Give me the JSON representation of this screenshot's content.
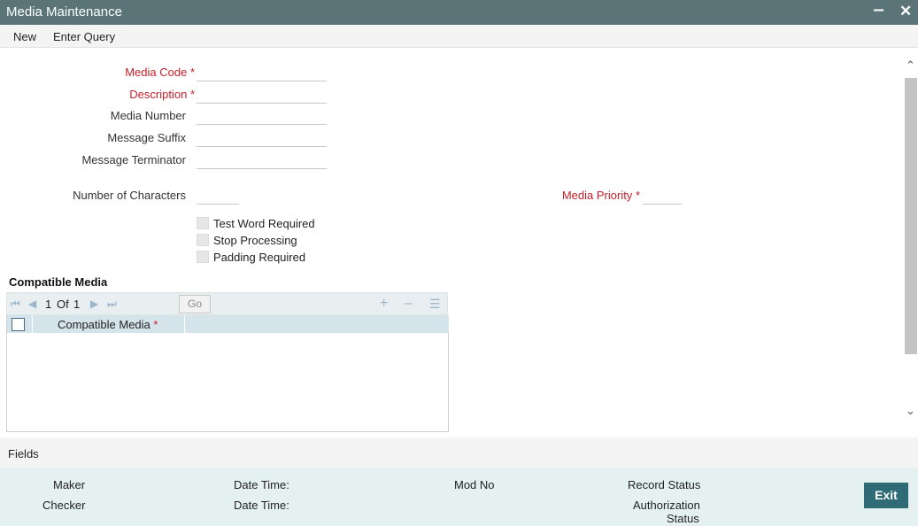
{
  "window": {
    "title": "Media Maintenance",
    "minimize_glyph": "‒",
    "close_glyph": "✕"
  },
  "menu": {
    "new": "New",
    "enter_query": "Enter Query"
  },
  "form": {
    "media_code": {
      "label": "Media Code",
      "required_mark": "*",
      "value": ""
    },
    "description": {
      "label": "Description",
      "required_mark": "*",
      "value": ""
    },
    "media_number": {
      "label": "Media Number",
      "value": ""
    },
    "message_suffix": {
      "label": "Message Suffix",
      "value": ""
    },
    "message_terminator": {
      "label": "Message Terminator",
      "value": ""
    },
    "number_of_characters": {
      "label": "Number of Characters",
      "value": ""
    },
    "media_priority": {
      "label": "Media Priority",
      "required_mark": "*",
      "value": ""
    },
    "test_word_required": {
      "label": "Test Word Required",
      "checked": false
    },
    "stop_processing": {
      "label": "Stop Processing",
      "checked": false
    },
    "padding_required": {
      "label": "Padding Required",
      "checked": false
    }
  },
  "compatible_media": {
    "section_title": "Compatible Media",
    "pager": {
      "current": "1",
      "of_label": "Of",
      "total": "1"
    },
    "go_label": "Go",
    "icons": {
      "first": "first-page-icon",
      "prev": "prev-page-icon",
      "next": "next-page-icon",
      "last": "last-page-icon",
      "add": "add-row-icon",
      "delete": "delete-row-icon",
      "single_view": "single-view-icon"
    },
    "columns": [
      {
        "label": "Compatible Media",
        "required_mark": "*"
      }
    ],
    "rows": []
  },
  "fields_bar": {
    "label": "Fields"
  },
  "footer": {
    "maker": "Maker",
    "maker_date_time": "Date Time:",
    "checker": "Checker",
    "checker_date_time": "Date Time:",
    "mod_no": "Mod No",
    "record_status": "Record Status",
    "authorization_status_line1": "Authorization",
    "authorization_status_line2": "Status",
    "exit": "Exit"
  },
  "colors": {
    "titlebar": "#5a7478",
    "required": "#c8202b",
    "exit_button": "#2f6b77",
    "footer_bg": "#e5f0f0",
    "grid_header": "#d4e4ea"
  }
}
